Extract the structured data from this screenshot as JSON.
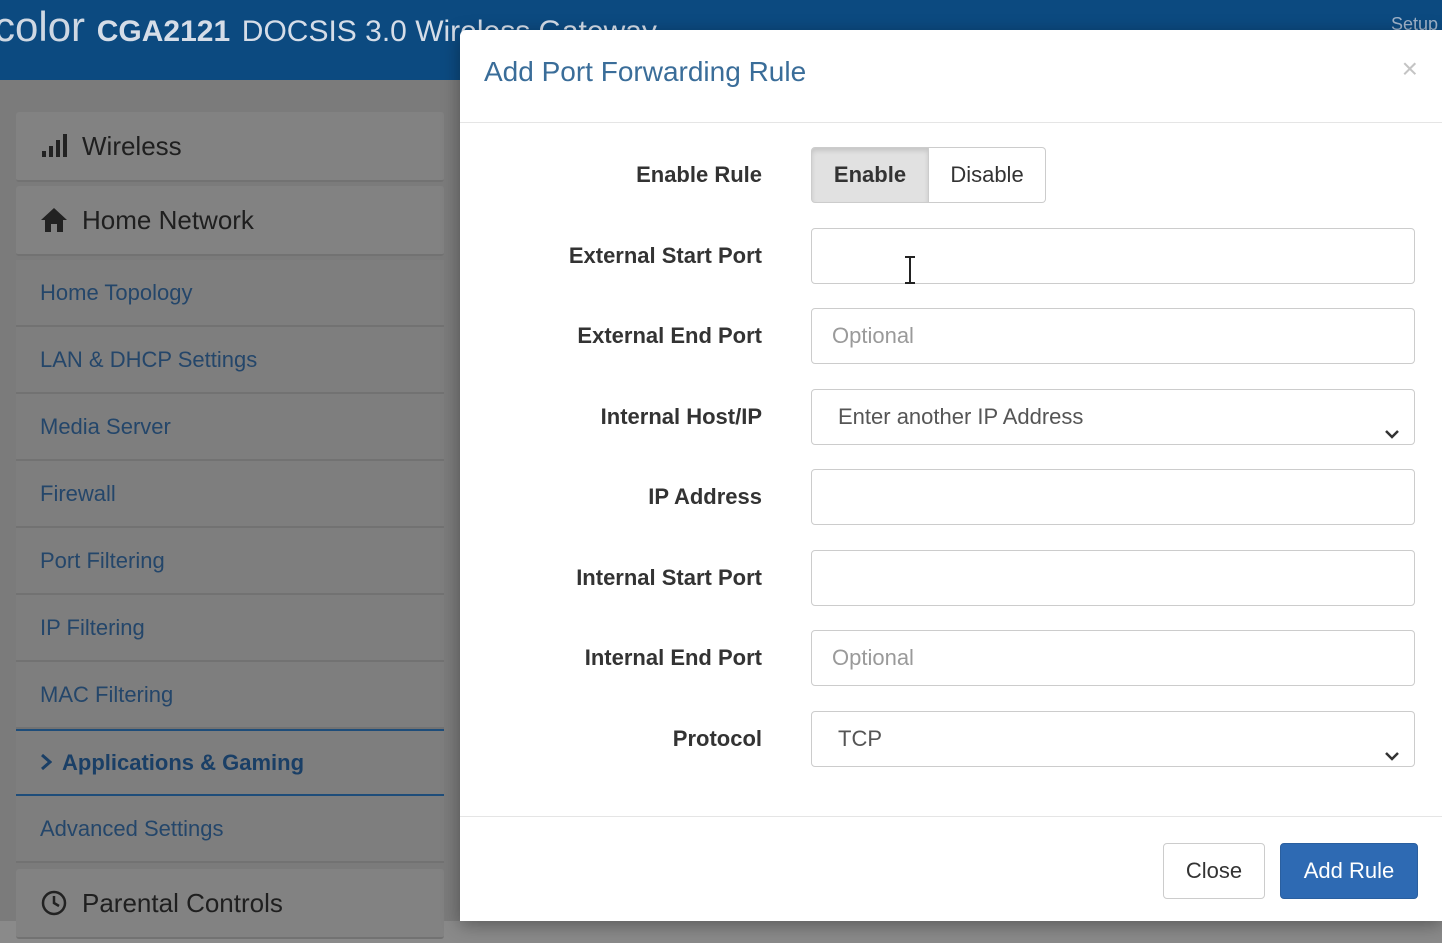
{
  "header": {
    "brand_prefix": "color",
    "model": "CGA2121",
    "product": "DOCSIS 3.0 Wireless Gateway",
    "setup_label": "Setup"
  },
  "sidebar": {
    "sections": [
      {
        "label": "Wireless",
        "icon": "signal-bars-icon"
      },
      {
        "label": "Home Network",
        "icon": "home-icon"
      }
    ],
    "items": [
      {
        "label": "Home Topology"
      },
      {
        "label": "LAN & DHCP Settings"
      },
      {
        "label": "Media Server"
      },
      {
        "label": "Firewall"
      },
      {
        "label": "Port Filtering"
      },
      {
        "label": "IP Filtering"
      },
      {
        "label": "MAC Filtering"
      },
      {
        "label": "Applications & Gaming",
        "active": true
      },
      {
        "label": "Advanced Settings"
      }
    ],
    "bottom_section": {
      "label": "Parental Controls",
      "icon": "clock-icon"
    }
  },
  "modal": {
    "title": "Add Port Forwarding Rule",
    "close_symbol": "×",
    "fields": {
      "enable_rule": {
        "label": "Enable Rule",
        "enable": "Enable",
        "disable": "Disable",
        "selected": "Enable"
      },
      "external_start_port": {
        "label": "External Start Port",
        "value": "",
        "placeholder": ""
      },
      "external_end_port": {
        "label": "External End Port",
        "value": "",
        "placeholder": "Optional"
      },
      "internal_host": {
        "label": "Internal Host/IP",
        "selected": "Enter another IP Address"
      },
      "ip_address": {
        "label": "IP Address",
        "value": "",
        "placeholder": ""
      },
      "internal_start_port": {
        "label": "Internal Start Port",
        "value": "",
        "placeholder": ""
      },
      "internal_end_port": {
        "label": "Internal End Port",
        "value": "",
        "placeholder": "Optional"
      },
      "protocol": {
        "label": "Protocol",
        "selected": "TCP"
      }
    },
    "buttons": {
      "close": "Close",
      "add": "Add Rule"
    }
  },
  "colors": {
    "topbar": "#0c4a80",
    "title": "#3a6d99",
    "primary_button": "#2e6ab3"
  }
}
